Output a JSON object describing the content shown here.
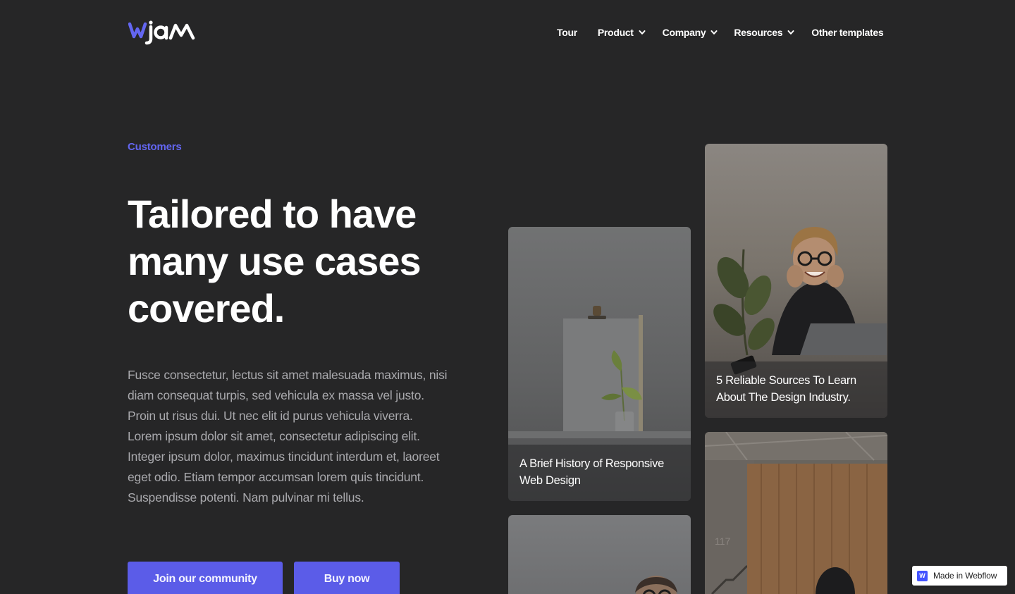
{
  "brand": {
    "logo_text": "wjam",
    "logo_colors": [
      "#6366f1",
      "#ffffff"
    ]
  },
  "nav": {
    "items": [
      {
        "label": "Tour",
        "has_dropdown": false
      },
      {
        "label": "Product",
        "has_dropdown": true
      },
      {
        "label": "Company",
        "has_dropdown": true
      },
      {
        "label": "Resources",
        "has_dropdown": true
      },
      {
        "label": "Other templates",
        "has_dropdown": false
      }
    ]
  },
  "hero": {
    "eyebrow": "Customers",
    "headline": "Tailored to have many use cases covered.",
    "paragraph_1": "Fusce consectetur, lectus sit amet malesuada maximus, nisi diam consequat turpis, sed vehicula ex massa vel justo. Proin ut risus dui. Ut nec elit id purus vehicula viverra.",
    "paragraph_2": "Lorem ipsum dolor sit amet, consectetur adipiscing elit. Integer ipsum dolor, maximus tincidunt interdum et, laoreet eget odio. Etiam tempor accumsan lorem quis tincidunt. Suspendisse potenti. Nam pulvinar mi tellus.",
    "cta_primary": "Join our community",
    "cta_secondary": "Buy now"
  },
  "cards": [
    {
      "title": "A Brief History of Responsive Web Design",
      "image": "plant-clipboard-photo"
    },
    {
      "title": "5 Reliable Sources To Learn About The Design Industry.",
      "image": "smiling-woman-laptop-photo"
    },
    {
      "title": "",
      "image": "man-glasses-photo"
    },
    {
      "title": "",
      "image": "wooden-office-wall-photo"
    }
  ],
  "badge": {
    "label": "Made in Webflow",
    "icon_letter": "W"
  },
  "colors": {
    "accent": "#6366f1",
    "background": "#262627",
    "button": "#5b5ce8"
  }
}
